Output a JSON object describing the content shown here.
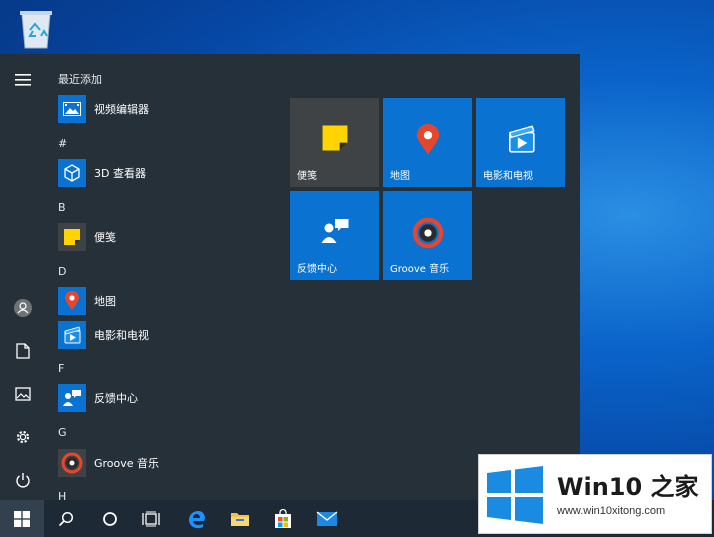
{
  "start_menu": {
    "groups": [
      {
        "head": "最近添加",
        "apps": [
          {
            "label": "视频编辑器",
            "icon": "video-editor-icon"
          }
        ]
      },
      {
        "head": "#",
        "apps": [
          {
            "label": "3D 查看器",
            "icon": "3d-viewer-icon"
          }
        ]
      },
      {
        "head": "B",
        "apps": [
          {
            "label": "便笺",
            "icon": "sticky-notes-icon"
          }
        ]
      },
      {
        "head": "D",
        "apps": [
          {
            "label": "地图",
            "icon": "maps-icon"
          },
          {
            "label": "电影和电视",
            "icon": "movies-tv-icon"
          }
        ]
      },
      {
        "head": "F",
        "apps": [
          {
            "label": "反馈中心",
            "icon": "feedback-hub-icon"
          }
        ]
      },
      {
        "head": "G",
        "apps": [
          {
            "label": "Groove 音乐",
            "icon": "groove-music-icon"
          }
        ]
      },
      {
        "head": "H",
        "apps": []
      }
    ],
    "tiles": [
      {
        "label": "便笺",
        "icon": "sticky-notes-icon"
      },
      {
        "label": "地图",
        "icon": "maps-icon"
      },
      {
        "label": "电影和电视",
        "icon": "movies-tv-icon"
      },
      {
        "label": "反馈中心",
        "icon": "feedback-hub-icon"
      },
      {
        "label": "Groove 音乐",
        "icon": "groove-music-icon"
      }
    ],
    "rail": [
      "hamburger-menu-icon",
      "user-avatar-icon",
      "documents-icon",
      "pictures-icon",
      "settings-gear-icon",
      "power-icon"
    ]
  },
  "taskbar": {
    "items": [
      "windows-start-icon",
      "search-icon",
      "cortana-icon",
      "task-view-icon",
      "edge-icon",
      "file-explorer-icon",
      "store-icon",
      "mail-icon"
    ]
  },
  "watermark": {
    "title": "Win10 之家",
    "url": "www.win10xitong.com"
  },
  "colors": {
    "accent": "#0a72d0",
    "menu_bg": "#253039",
    "taskbar_bg": "#1d2a36"
  }
}
